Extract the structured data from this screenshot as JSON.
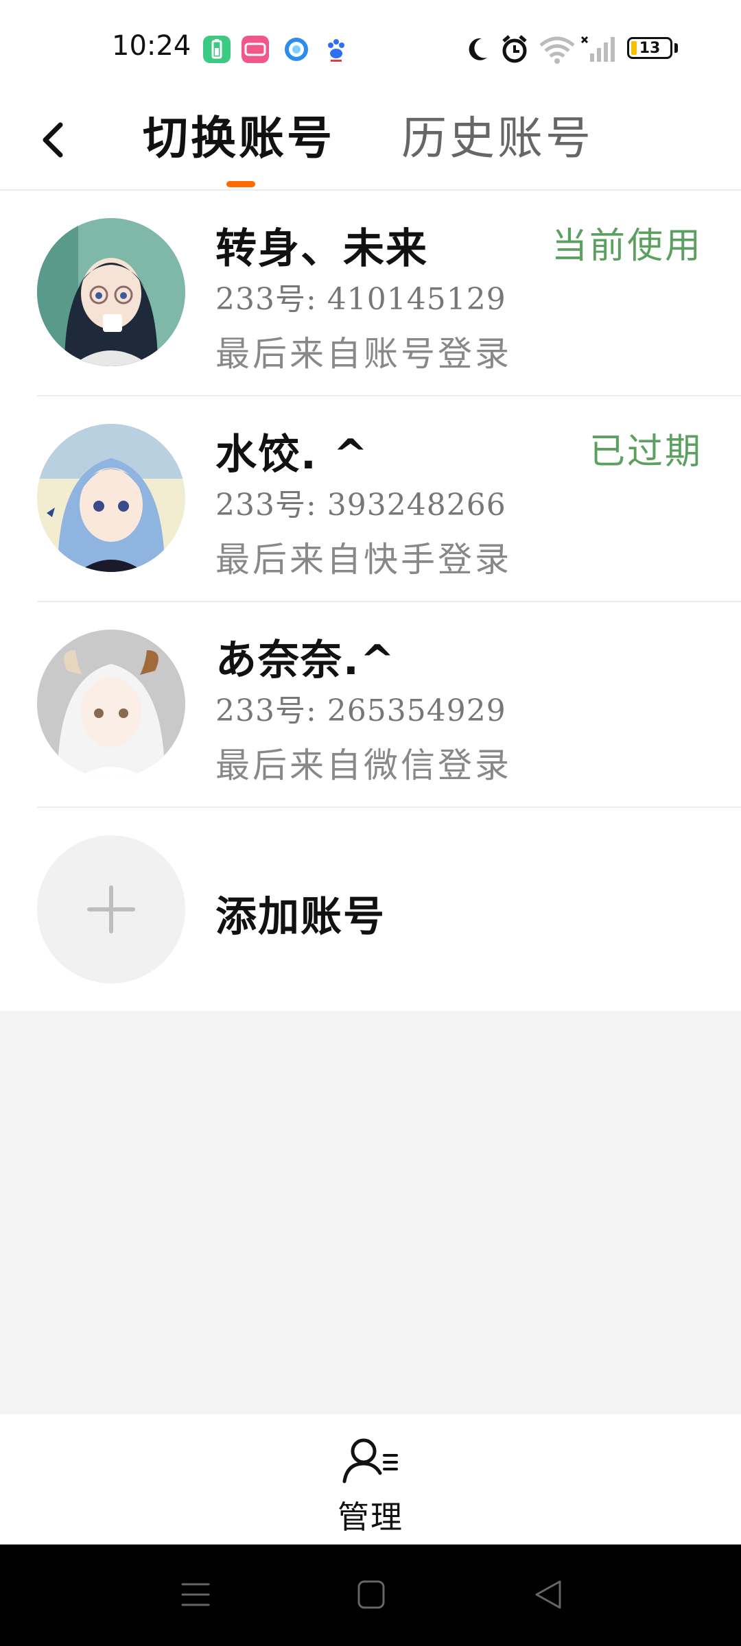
{
  "status_bar": {
    "time": "10:24",
    "battery_level": "13",
    "icons": [
      "battery-saver-app-icon",
      "bilibili-app-icon",
      "browser-app-icon",
      "baidu-app-icon",
      "do-not-disturb-moon-icon",
      "alarm-icon",
      "wifi-icon",
      "signal-icon",
      "battery-icon"
    ]
  },
  "nav": {
    "active_tab": "切换账号",
    "inactive_tab": "历史账号"
  },
  "accounts": [
    {
      "name": "转身、未来",
      "uid": "233号: 410145129",
      "login_source": "最后来自账号登录",
      "status": "当前使用"
    },
    {
      "name": "水饺. ^",
      "uid": "233号: 393248266",
      "login_source": "最后来自快手登录",
      "status": "已过期"
    },
    {
      "name": "あ奈奈.^",
      "uid": "233号: 265354929",
      "login_source": "最后来自微信登录",
      "status": ""
    }
  ],
  "add_account": {
    "label": "添加账号"
  },
  "bottom": {
    "manage_label": "管理"
  },
  "colors": {
    "accent": "#ff6a00",
    "status_green": "#5aa05e",
    "background_gray": "#f4f4f4"
  }
}
